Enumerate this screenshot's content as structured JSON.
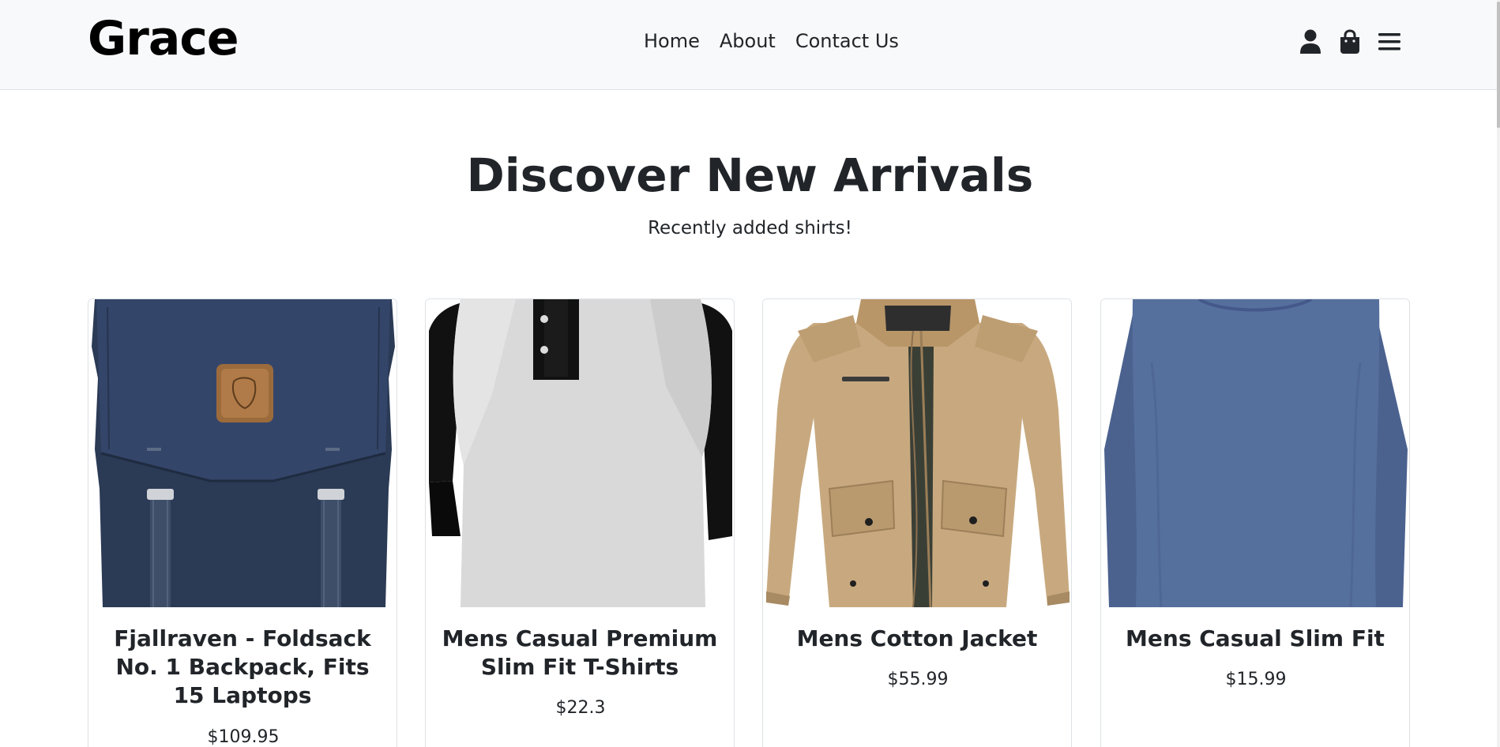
{
  "brand": "Grace",
  "nav": {
    "links": [
      "Home",
      "About",
      "Contact Us"
    ],
    "icons": [
      "user-icon",
      "shopping-bag-icon",
      "menu-icon"
    ]
  },
  "hero": {
    "title": "Discover New Arrivals",
    "subtitle": "Recently added shirts!"
  },
  "products": [
    {
      "title": "Fjallraven - Foldsack No. 1 Backpack, Fits 15 Laptops",
      "price": "$109.95",
      "image": "navy-backpack"
    },
    {
      "title": "Mens Casual Premium Slim Fit T-Shirts",
      "price": "$22.3",
      "image": "raglan-henley-shirt"
    },
    {
      "title": "Mens Cotton Jacket",
      "price": "$55.99",
      "image": "khaki-jacket"
    },
    {
      "title": "Mens Casual Slim Fit",
      "price": "$15.99",
      "image": "blue-long-sleeve-shirt"
    }
  ],
  "colors": {
    "navbar_bg": "#f8f9fa",
    "text": "#212529",
    "card_border": "#dee2e6"
  }
}
